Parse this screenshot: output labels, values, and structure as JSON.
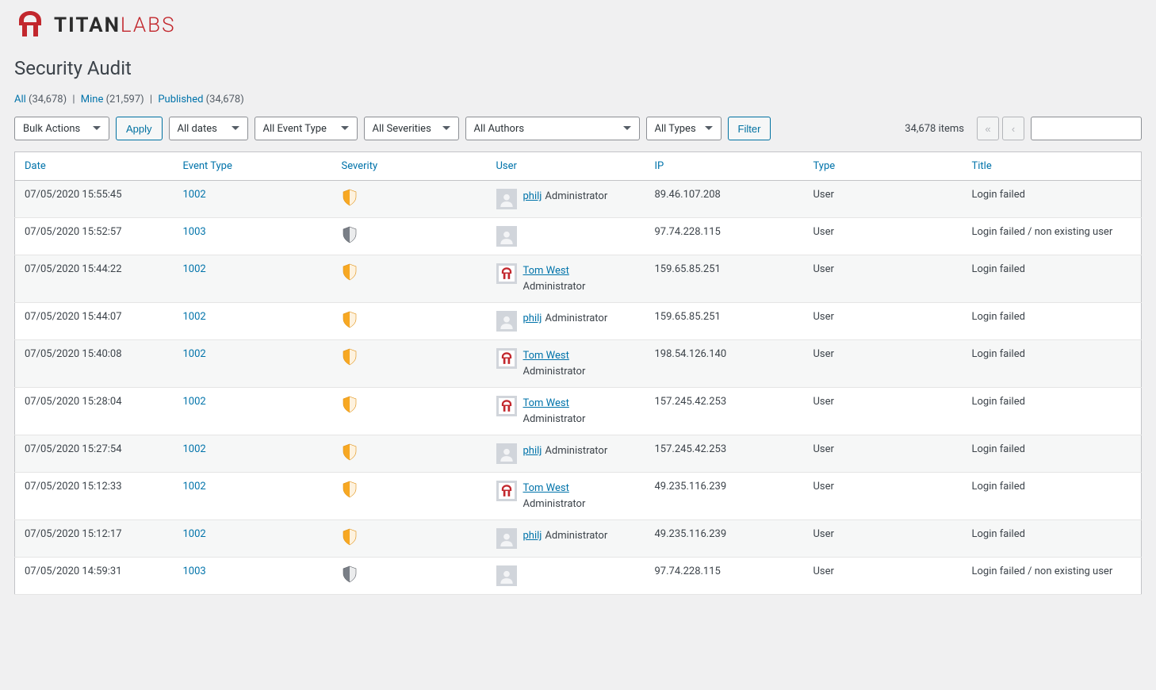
{
  "brand": {
    "name1": "TITAN",
    "name2": "LABS"
  },
  "page_title": "Security Audit",
  "status_links": {
    "all_label": "All",
    "all_count": "(34,678)",
    "mine_label": "Mine",
    "mine_count": "(21,597)",
    "published_label": "Published",
    "published_count": "(34,678)"
  },
  "toolbar": {
    "bulk_label": "Bulk Actions",
    "apply_label": "Apply",
    "dates_label": "All dates",
    "event_type_label": "All Event Type",
    "severities_label": "All Severities",
    "authors_label": "All Authors",
    "types_label": "All Types",
    "filter_label": "Filter",
    "items_count": "34,678 items",
    "pager_first": "«",
    "pager_prev": "‹"
  },
  "columns": {
    "date": "Date",
    "event_type": "Event Type",
    "severity": "Severity",
    "user": "User",
    "ip": "IP",
    "type": "Type",
    "title": "Title"
  },
  "rows": [
    {
      "date": "07/05/2020 15:55:45",
      "event": "1002",
      "sev": "warn",
      "avatar": "gray",
      "username": "philj",
      "role": "Administrator",
      "role_below": false,
      "ip": "89.46.107.208",
      "type": "User",
      "title": "Login failed"
    },
    {
      "date": "07/05/2020 15:52:57",
      "event": "1003",
      "sev": "neutral",
      "avatar": "gray",
      "username": "",
      "role": "",
      "role_below": false,
      "ip": "97.74.228.115",
      "type": "User",
      "title": "Login failed / non existing user"
    },
    {
      "date": "07/05/2020 15:44:22",
      "event": "1002",
      "sev": "warn",
      "avatar": "titan",
      "username": "Tom West",
      "role": "Administrator",
      "role_below": true,
      "ip": "159.65.85.251",
      "type": "User",
      "title": "Login failed"
    },
    {
      "date": "07/05/2020 15:44:07",
      "event": "1002",
      "sev": "warn",
      "avatar": "gray",
      "username": "philj",
      "role": "Administrator",
      "role_below": false,
      "ip": "159.65.85.251",
      "type": "User",
      "title": "Login failed"
    },
    {
      "date": "07/05/2020 15:40:08",
      "event": "1002",
      "sev": "warn",
      "avatar": "titan",
      "username": "Tom West",
      "role": "Administrator",
      "role_below": true,
      "ip": "198.54.126.140",
      "type": "User",
      "title": "Login failed"
    },
    {
      "date": "07/05/2020 15:28:04",
      "event": "1002",
      "sev": "warn",
      "avatar": "titan",
      "username": "Tom West",
      "role": "Administrator",
      "role_below": true,
      "ip": "157.245.42.253",
      "type": "User",
      "title": "Login failed"
    },
    {
      "date": "07/05/2020 15:27:54",
      "event": "1002",
      "sev": "warn",
      "avatar": "gray",
      "username": "philj",
      "role": "Administrator",
      "role_below": false,
      "ip": "157.245.42.253",
      "type": "User",
      "title": "Login failed"
    },
    {
      "date": "07/05/2020 15:12:33",
      "event": "1002",
      "sev": "warn",
      "avatar": "titan",
      "username": "Tom West",
      "role": "Administrator",
      "role_below": true,
      "ip": "49.235.116.239",
      "type": "User",
      "title": "Login failed"
    },
    {
      "date": "07/05/2020 15:12:17",
      "event": "1002",
      "sev": "warn",
      "avatar": "gray",
      "username": "philj",
      "role": "Administrator",
      "role_below": false,
      "ip": "49.235.116.239",
      "type": "User",
      "title": "Login failed"
    },
    {
      "date": "07/05/2020 14:59:31",
      "event": "1003",
      "sev": "neutral",
      "avatar": "gray",
      "username": "",
      "role": "",
      "role_below": false,
      "ip": "97.74.228.115",
      "type": "User",
      "title": "Login failed / non existing user"
    }
  ]
}
